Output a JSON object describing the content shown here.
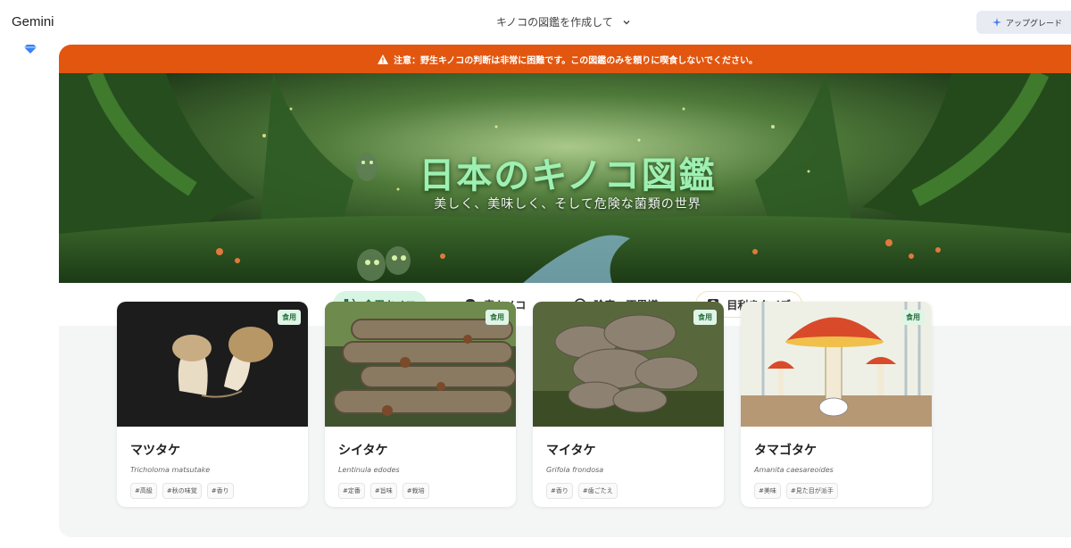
{
  "app": {
    "brand": "Gemini",
    "conversation_title": "キノコの図鑑を作成して",
    "upgrade_label": "アップグレード"
  },
  "warning": {
    "text": "注意：野生キノコの判断は非常に困難です。この図鑑のみを頼りに喫食しないでください。"
  },
  "hero": {
    "title": "日本のキノコ図鑑",
    "subtitle": "美しく、美味しく、そして危険な菌類の世界"
  },
  "tabs": [
    {
      "label": "食用キノコ",
      "icon": "fork-knife-icon",
      "active": true
    },
    {
      "label": "毒キノコ",
      "icon": "skull-icon",
      "active": false
    },
    {
      "label": "珍奇・不思議",
      "icon": "circle-icon",
      "active": false
    },
    {
      "label": "目利きクイズ",
      "icon": "quiz-icon",
      "active": false
    }
  ],
  "cards": [
    {
      "name": "マツタケ",
      "latin": "Tricholoma matsutake",
      "badge": "食用",
      "tags": [
        "#高級",
        "#秋の味覚",
        "#香り"
      ]
    },
    {
      "name": "シイタケ",
      "latin": "Lentinula edodes",
      "badge": "食用",
      "tags": [
        "#定番",
        "#旨味",
        "#栽培"
      ]
    },
    {
      "name": "マイタケ",
      "latin": "Grifola frondosa",
      "badge": "食用",
      "tags": [
        "#香り",
        "#歯ごたえ"
      ]
    },
    {
      "name": "タマゴタケ",
      "latin": "Amanita caesareoides",
      "badge": "食用",
      "tags": [
        "#美味",
        "#見た目が派手"
      ]
    }
  ],
  "colors": {
    "warning_bg": "#e2560f",
    "accent_green": "#9df0b2",
    "tab_active_bg": "#d8f5e3"
  }
}
